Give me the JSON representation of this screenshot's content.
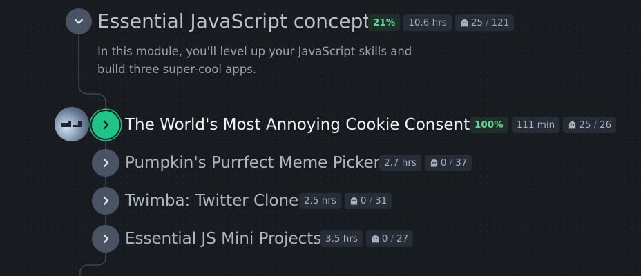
{
  "module": {
    "title": "Essential JavaScript concepts",
    "progress": "21%",
    "duration": "10.6 hrs",
    "challenges_done": "25",
    "challenges_total": "121",
    "description": "In this module, you'll level up your JavaScript skills and build three super-cool apps."
  },
  "lessons": [
    {
      "title": "The World's Most Annoying Cookie Consent",
      "progress": "100%",
      "duration": "111 min",
      "challenges_done": "25",
      "challenges_total": "26",
      "active": true
    },
    {
      "title": "Pumpkin's Purrfect Meme Picker",
      "duration": "2.7 hrs",
      "challenges_done": "0",
      "challenges_total": "37"
    },
    {
      "title": "Twimba: Twitter Clone",
      "duration": "2.5 hrs",
      "challenges_done": "0",
      "challenges_total": "31"
    },
    {
      "title": "Essential JS Mini Projects",
      "duration": "3.5 hrs",
      "challenges_done": "0",
      "challenges_total": "27"
    }
  ],
  "icons": {
    "module_toggle": "chevron-down-icon",
    "lesson_toggle": "chevron-right-icon",
    "challenge": "ghost-icon",
    "avatar": "scrimba-avatar"
  },
  "colors": {
    "background": "#181c21",
    "accent_green": "#1fc489",
    "progress_green": "#5fd896",
    "toggle_gray": "#4a5364"
  }
}
